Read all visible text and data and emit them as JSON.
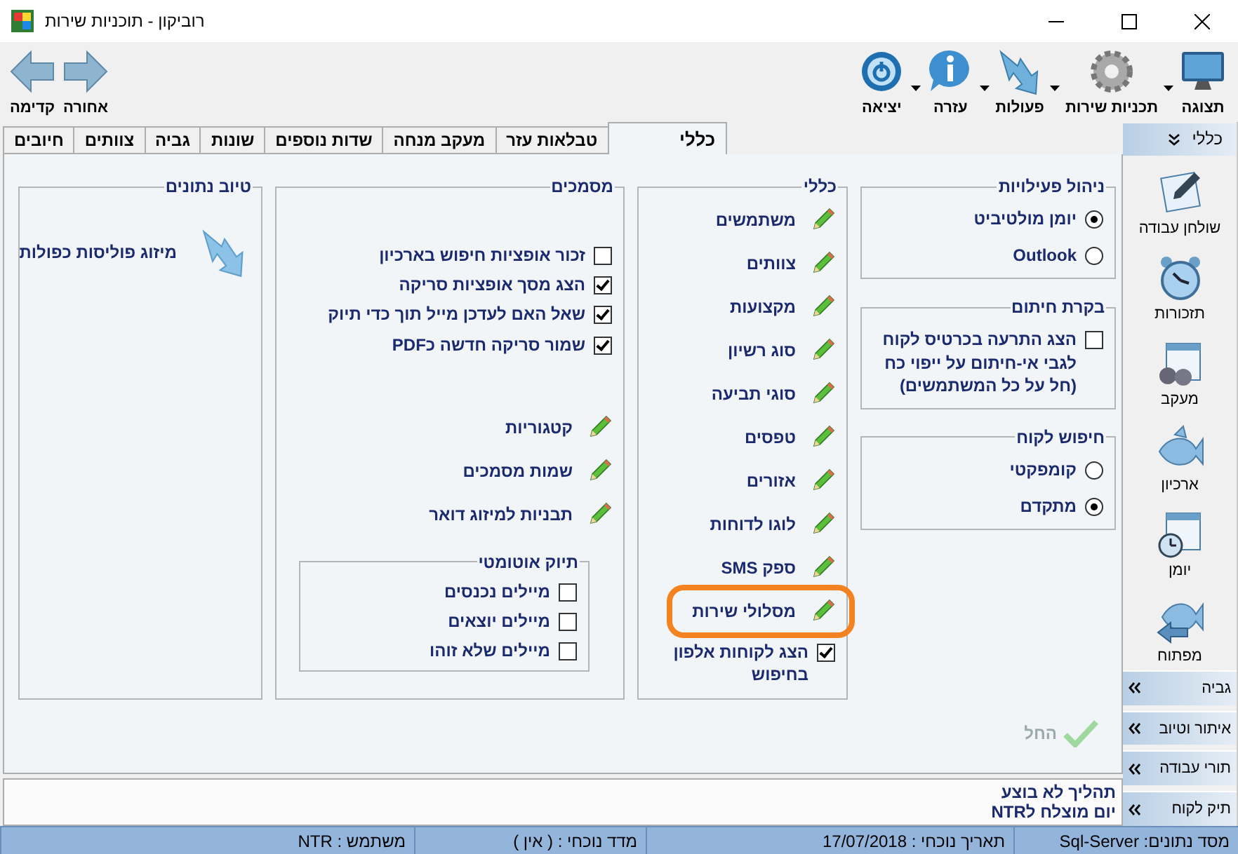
{
  "window": {
    "title": "רוביקון - תוכניות שירות"
  },
  "toolbar": {
    "items": [
      {
        "label": "תצוגה",
        "dropdown": true
      },
      {
        "label": "תכניות שירות",
        "dropdown": true
      },
      {
        "label": "פעולות",
        "dropdown": true
      },
      {
        "label": "עזרה",
        "dropdown": true
      },
      {
        "label": "יציאה",
        "dropdown": false
      }
    ],
    "nav": [
      {
        "label": "אחורה"
      },
      {
        "label": "קדימה"
      }
    ]
  },
  "tabs": [
    {
      "label": "כללי",
      "selected": true
    },
    {
      "label": "טבלאות עזר",
      "selected": false
    },
    {
      "label": "מעקב מנחה",
      "selected": false
    },
    {
      "label": "שדות נוספים",
      "selected": false
    },
    {
      "label": "שונות",
      "selected": false
    },
    {
      "label": "גביה",
      "selected": false
    },
    {
      "label": "צוותים",
      "selected": false
    },
    {
      "label": "חיובים",
      "selected": false
    }
  ],
  "columns": [
    [
      {
        "title": "ניהול פעילויות",
        "items": [
          {
            "kind": "radio",
            "label": "יומן מולטיביט",
            "checked": true
          },
          {
            "kind": "radio",
            "label": "Outlook",
            "checked": false
          }
        ]
      },
      {
        "title": "בקרת חיתום",
        "items": [
          {
            "kind": "checkbox",
            "label": "הצג התרעה בכרטיס לקוח לגבי אי-חיתום על ייפוי כח (חל על כל המשתמשים)",
            "checked": false
          }
        ]
      },
      {
        "title": "חיפוש לקוח",
        "items": [
          {
            "kind": "radio",
            "label": "קומפקטי",
            "checked": false
          },
          {
            "kind": "radio",
            "label": "מתקדם",
            "checked": true
          }
        ]
      }
    ],
    [
      {
        "title": "כללי",
        "items": [
          {
            "kind": "link",
            "label": "משתמשים"
          },
          {
            "kind": "link",
            "label": "צוותים"
          },
          {
            "kind": "link",
            "label": "מקצועות"
          },
          {
            "kind": "link",
            "label": "סוג רשיון"
          },
          {
            "kind": "link",
            "label": "סוגי תביעה"
          },
          {
            "kind": "link",
            "label": "טפסים"
          },
          {
            "kind": "link",
            "label": "אזורים"
          },
          {
            "kind": "link",
            "label": "לוגו לדוחות"
          },
          {
            "kind": "link",
            "label": "ספק SMS"
          },
          {
            "kind": "link",
            "label": "מסלולי שירות",
            "highlighted": true
          },
          {
            "kind": "checkbox",
            "label": "הצג לקוחות אלפון בחיפוש",
            "checked": true
          }
        ]
      }
    ],
    [
      {
        "title": "מסמכים",
        "items": [
          {
            "kind": "checkbox",
            "label": "זכור אופציות חיפוש בארכיון",
            "checked": false
          },
          {
            "kind": "checkbox",
            "label": "הצג מסך אופציות סריקה",
            "checked": true
          },
          {
            "kind": "checkbox",
            "label": "שאל האם לעדכן מייל תוך כדי תיוק",
            "checked": true
          },
          {
            "kind": "checkbox",
            "label": "שמור סריקה חדשה כPDF",
            "checked": true
          },
          {
            "kind": "link",
            "label": "קטגוריות"
          },
          {
            "kind": "link",
            "label": "שמות מסמכים"
          },
          {
            "kind": "link",
            "label": "תבניות למיזוג דואר"
          },
          {
            "kind": "group",
            "title": "תיוק אוטומטי",
            "items": [
              {
                "kind": "checkbox",
                "label": "מיילים נכנסים",
                "checked": false
              },
              {
                "kind": "checkbox",
                "label": "מיילים יוצאים",
                "checked": false
              },
              {
                "kind": "checkbox",
                "label": "מיילים שלא זוהו",
                "checked": false
              }
            ]
          }
        ]
      }
    ],
    [
      {
        "title": "טיוב נתונים",
        "items": [
          {
            "kind": "action",
            "label": "מיזוג פוליסות כפולות"
          }
        ]
      }
    ]
  ],
  "apply": {
    "label": "החל",
    "disabled": true
  },
  "messages": [
    "תהליך לא בוצע",
    "יום מוצלח לNTR"
  ],
  "sidebar": {
    "header": "כללי",
    "items": [
      {
        "label": "שולחן עבודה"
      },
      {
        "label": "תזכורות"
      },
      {
        "label": "מעקב"
      },
      {
        "label": "ארכיון"
      },
      {
        "label": "יומן"
      },
      {
        "label": "מפתוח"
      }
    ],
    "sections": [
      "גביה",
      "איתור וטיוב",
      "תורי עבודה",
      "תיק לקוח"
    ]
  },
  "status_bar": [
    "מסד נתונים: Sql-Server",
    "תאריך נוכחי : 17/07/2018",
    "מדד נוכחי : ( אין )",
    "משתמש : NTR"
  ]
}
